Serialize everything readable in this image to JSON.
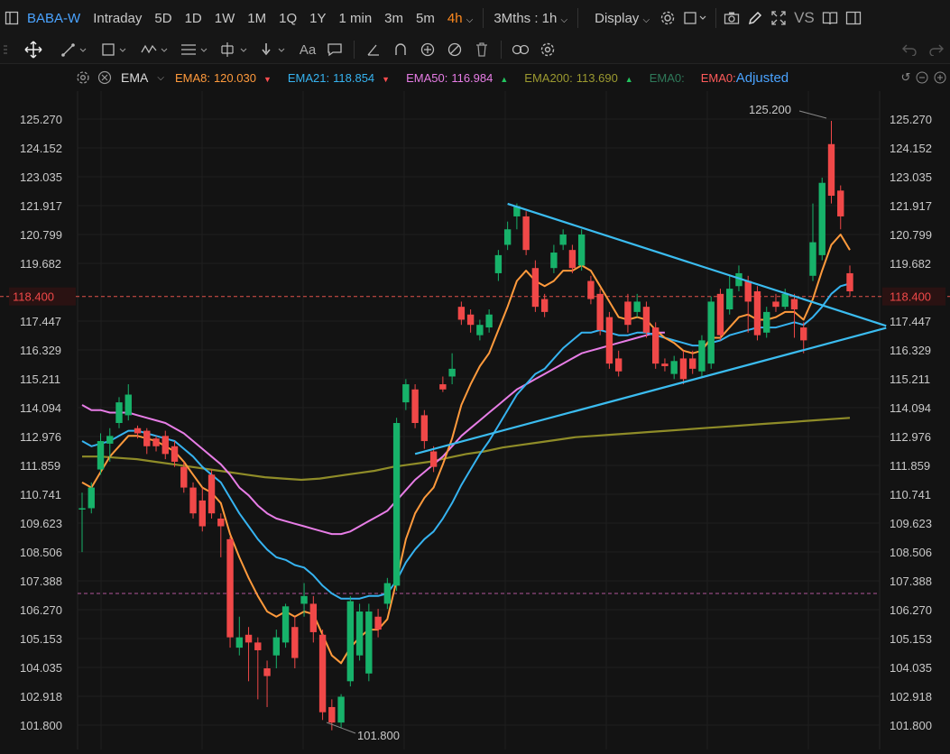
{
  "topbar": {
    "symbol": "BABA-W",
    "periods": [
      "Intraday",
      "5D",
      "1D",
      "1W",
      "1M",
      "1Q",
      "1Y",
      "1 min",
      "3m",
      "5m"
    ],
    "active_period": "4h",
    "range_label": "3Mths : 1h",
    "display_label": "Display",
    "vs_label": "VS"
  },
  "toolbar": {
    "text_tool_label": "Aa"
  },
  "indicators": {
    "name": "EMA",
    "items": [
      {
        "label": "EMA8:",
        "value": "120.030",
        "color": "#ff9a3c",
        "arrow": "▼",
        "arrow_color": "#ff4d4f"
      },
      {
        "label": "EMA21:",
        "value": "118.854",
        "color": "#36b3f0",
        "arrow": "▼",
        "arrow_color": "#ff4d4f"
      },
      {
        "label": "EMA50:",
        "value": "116.984",
        "color": "#e77de6",
        "arrow": "▲",
        "arrow_color": "#22c55e"
      },
      {
        "label": "EMA200:",
        "value": "113.690",
        "color": "#9c9a30",
        "arrow": "▲",
        "arrow_color": "#22c55e"
      },
      {
        "label": "EMA0:",
        "value": "",
        "color": "#2f7a5a",
        "arrow": "",
        "arrow_color": ""
      },
      {
        "label": "EMA0:",
        "value": "Adjusted",
        "color": "#ff5b5b",
        "arrow": "",
        "arrow_color": ""
      }
    ]
  },
  "colors": {
    "up": "#17b26a",
    "down": "#f04848",
    "ema8": "#ff9a3c",
    "ema21": "#36b3f0",
    "ema50": "#e77de6",
    "ema200": "#8f8c28",
    "trendline": "#3bbcf0"
  },
  "price_axis": {
    "ticks": [
      "125.270",
      "124.152",
      "123.035",
      "121.917",
      "120.799",
      "119.682",
      "118.400",
      "117.447",
      "116.329",
      "115.211",
      "114.094",
      "112.976",
      "111.859",
      "110.741",
      "109.623",
      "108.506",
      "107.388",
      "106.270",
      "105.153",
      "104.035",
      "102.918",
      "101.800"
    ],
    "current_price": "118.400",
    "reference_level": 106.9
  },
  "chart_data": {
    "type": "candlestick",
    "ylim": [
      101.2,
      126.0
    ],
    "high_label": "125.200",
    "low_label": "101.800",
    "candles": [
      [
        110.2,
        110.2,
        110.8,
        108.5
      ],
      [
        110.2,
        111.0,
        111.2,
        110.0
      ],
      [
        111.7,
        112.8,
        113.1,
        111.5
      ],
      [
        112.7,
        113.0,
        113.3,
        112.0
      ],
      [
        113.5,
        114.3,
        114.5,
        113.3
      ],
      [
        113.8,
        114.6,
        115.0,
        113.6
      ],
      [
        113.3,
        113.1,
        113.4,
        112.9
      ],
      [
        113.2,
        112.6,
        113.3,
        112.3
      ],
      [
        112.9,
        112.6,
        113.0,
        112.4
      ],
      [
        113.0,
        112.3,
        113.2,
        112.1
      ],
      [
        112.6,
        112.0,
        112.8,
        111.8
      ],
      [
        111.8,
        111.0,
        112.0,
        110.8
      ],
      [
        111.0,
        110.0,
        111.2,
        109.8
      ],
      [
        110.5,
        109.5,
        111.0,
        109.3
      ],
      [
        111.5,
        110.0,
        111.7,
        109.8
      ],
      [
        109.8,
        109.5,
        110.0,
        108.3
      ],
      [
        109.0,
        105.2,
        109.1,
        104.8
      ],
      [
        104.8,
        105.2,
        106.0,
        104.5
      ],
      [
        105.3,
        105.0,
        105.6,
        103.5
      ],
      [
        105.0,
        104.7,
        105.2,
        102.8
      ],
      [
        104.0,
        103.7,
        104.3,
        102.5
      ],
      [
        104.5,
        105.2,
        105.5,
        104.0
      ],
      [
        105.0,
        106.4,
        106.5,
        104.8
      ],
      [
        105.6,
        104.4,
        106.0,
        104.0
      ],
      [
        106.5,
        106.8,
        107.3,
        106.0
      ],
      [
        106.5,
        105.4,
        106.8,
        105.0
      ],
      [
        105.3,
        102.3,
        105.5,
        102.0
      ],
      [
        102.5,
        101.9,
        102.8,
        101.6
      ],
      [
        101.9,
        102.9,
        103.0,
        101.7
      ],
      [
        103.5,
        106.6,
        106.8,
        103.3
      ],
      [
        104.5,
        106.2,
        106.5,
        104.3
      ],
      [
        103.8,
        106.2,
        106.5,
        103.5
      ],
      [
        106.0,
        105.5,
        106.3,
        105.2
      ],
      [
        106.5,
        107.3,
        107.5,
        106.3
      ],
      [
        107.2,
        113.5,
        113.7,
        107.0
      ],
      [
        114.3,
        115.0,
        115.2,
        114.0
      ],
      [
        114.8,
        113.5,
        115.0,
        113.3
      ],
      [
        113.8,
        112.8,
        114.0,
        112.5
      ],
      [
        112.4,
        111.8,
        112.6,
        111.6
      ],
      [
        115.0,
        114.8,
        115.3,
        114.7
      ],
      [
        115.3,
        115.6,
        116.2,
        115.0
      ],
      [
        118.0,
        117.5,
        118.2,
        117.3
      ],
      [
        117.7,
        117.3,
        117.9,
        117.0
      ],
      [
        116.9,
        117.3,
        117.5,
        116.7
      ],
      [
        117.2,
        117.7,
        117.9,
        117.0
      ],
      [
        119.3,
        120.0,
        120.2,
        119.0
      ],
      [
        120.4,
        121.0,
        121.3,
        120.2
      ],
      [
        121.5,
        121.9,
        122.0,
        121.0
      ],
      [
        121.5,
        120.2,
        121.7,
        120.0
      ],
      [
        119.5,
        118.0,
        119.8,
        117.8
      ],
      [
        118.3,
        117.8,
        118.5,
        117.6
      ],
      [
        119.5,
        120.1,
        120.4,
        119.3
      ],
      [
        120.4,
        120.8,
        121.0,
        120.2
      ],
      [
        120.2,
        119.5,
        120.4,
        119.3
      ],
      [
        119.6,
        120.8,
        121.0,
        119.4
      ],
      [
        119.0,
        118.3,
        119.2,
        118.1
      ],
      [
        118.5,
        117.1,
        118.7,
        116.9
      ],
      [
        117.6,
        115.8,
        117.8,
        115.6
      ],
      [
        116.0,
        115.5,
        116.3,
        115.3
      ],
      [
        118.2,
        117.3,
        118.5,
        117.0
      ],
      [
        117.8,
        118.2,
        118.5,
        117.6
      ],
      [
        118.0,
        117.0,
        118.2,
        116.8
      ],
      [
        117.2,
        115.8,
        117.4,
        115.6
      ],
      [
        115.8,
        115.7,
        116.0,
        115.5
      ],
      [
        115.4,
        115.9,
        116.1,
        115.2
      ],
      [
        116.0,
        115.2,
        116.3,
        115.0
      ],
      [
        116.0,
        115.6,
        116.3,
        115.4
      ],
      [
        115.5,
        116.7,
        116.9,
        115.3
      ],
      [
        115.8,
        118.2,
        118.4,
        115.6
      ],
      [
        118.5,
        116.9,
        118.7,
        116.7
      ],
      [
        117.9,
        118.7,
        119.2,
        117.7
      ],
      [
        118.8,
        119.3,
        119.6,
        118.6
      ],
      [
        119.0,
        118.2,
        119.2,
        117.0
      ],
      [
        118.6,
        116.9,
        118.8,
        116.7
      ],
      [
        117.0,
        117.8,
        118.0,
        116.8
      ],
      [
        118.2,
        118.0,
        118.5,
        117.8
      ],
      [
        118.0,
        118.5,
        118.7,
        117.9
      ],
      [
        118.3,
        117.9,
        118.5,
        116.8
      ],
      [
        117.2,
        116.7,
        117.4,
        116.2
      ],
      [
        119.2,
        120.5,
        122.0,
        119.0
      ],
      [
        120.0,
        122.8,
        123.0,
        119.8
      ],
      [
        124.3,
        122.3,
        125.2,
        122.0
      ],
      [
        122.5,
        121.5,
        122.7,
        121.0
      ],
      [
        119.3,
        118.6,
        119.6,
        118.4
      ]
    ],
    "ema8": [
      111.2,
      111.0,
      111.6,
      112.2,
      112.6,
      113.0,
      113.0,
      112.9,
      112.8,
      112.6,
      112.4,
      112.0,
      111.5,
      111.0,
      110.8,
      110.4,
      109.2,
      108.3,
      107.5,
      106.8,
      106.2,
      106.0,
      106.2,
      106.0,
      106.2,
      106.1,
      105.3,
      104.5,
      104.2,
      104.8,
      105.2,
      105.5,
      105.5,
      105.9,
      107.4,
      109.0,
      110.0,
      110.6,
      111.0,
      111.9,
      112.9,
      114.2,
      115.0,
      115.7,
      116.2,
      117.1,
      118.0,
      119.0,
      119.4,
      119.0,
      118.8,
      119.0,
      119.4,
      119.4,
      119.6,
      119.4,
      118.8,
      118.2,
      117.6,
      117.5,
      117.6,
      117.5,
      117.1,
      116.8,
      116.6,
      116.3,
      116.2,
      116.3,
      116.8,
      116.8,
      117.2,
      117.6,
      117.7,
      117.5,
      117.5,
      117.6,
      117.8,
      117.8,
      117.5,
      118.3,
      119.4,
      120.4,
      120.8,
      120.2
    ],
    "ema21": [
      112.8,
      112.6,
      112.7,
      112.8,
      113.0,
      113.2,
      113.2,
      113.1,
      113.0,
      112.9,
      112.8,
      112.5,
      112.2,
      111.8,
      111.5,
      111.2,
      110.6,
      110.0,
      109.5,
      109.0,
      108.6,
      108.3,
      108.2,
      108.0,
      107.9,
      107.6,
      107.2,
      106.9,
      106.7,
      106.7,
      106.7,
      106.8,
      106.8,
      106.9,
      107.4,
      108.1,
      108.6,
      109.0,
      109.3,
      109.8,
      110.4,
      111.1,
      111.7,
      112.3,
      112.8,
      113.4,
      114.0,
      114.6,
      115.0,
      115.4,
      115.6,
      116.0,
      116.4,
      116.7,
      117.0,
      117.0,
      117.1,
      117.0,
      116.9,
      116.9,
      117.0,
      117.0,
      116.9,
      116.8,
      116.7,
      116.6,
      116.5,
      116.5,
      116.6,
      116.7,
      116.9,
      117.0,
      117.1,
      117.2,
      117.2,
      117.2,
      117.3,
      117.4,
      117.3,
      117.6,
      118.0,
      118.5,
      118.8,
      118.9
    ],
    "ema50": [
      114.2,
      114.0,
      114.0,
      113.9,
      113.9,
      113.9,
      113.8,
      113.7,
      113.6,
      113.5,
      113.3,
      113.1,
      112.8,
      112.5,
      112.2,
      111.9,
      111.5,
      111.0,
      110.7,
      110.3,
      110.0,
      109.8,
      109.7,
      109.6,
      109.5,
      109.4,
      109.3,
      109.2,
      109.2,
      109.3,
      109.5,
      109.7,
      109.9,
      110.1,
      110.5,
      110.9,
      111.3,
      111.6,
      111.9,
      112.2,
      112.6,
      113.0,
      113.3,
      113.6,
      113.9,
      114.2,
      114.5,
      114.8,
      115.0,
      115.2,
      115.4,
      115.6,
      115.8,
      116.0,
      116.2,
      116.3,
      116.4,
      116.5,
      116.6,
      116.7,
      116.8,
      116.9,
      117.0,
      117.0
    ],
    "ema200": [
      112.2,
      112.2,
      112.2,
      112.2,
      112.2,
      112.2,
      112.1,
      112.1,
      112.0,
      111.9,
      111.8,
      111.7,
      111.6,
      111.5,
      111.4,
      111.4,
      111.3,
      111.4,
      111.5,
      111.6,
      111.8,
      111.9,
      112.0,
      112.2,
      112.3,
      112.5,
      112.6,
      112.8,
      112.9,
      113.0,
      113.1,
      113.2,
      113.3,
      113.4,
      113.6,
      113.7,
      113.8,
      114.0,
      114.1,
      114.3,
      114.4,
      114.5,
      114.7,
      114.8,
      115.0,
      115.1,
      115.2,
      115.3,
      115.5,
      115.6,
      115.7,
      115.9,
      116.0,
      116.1,
      116.3,
      116.4,
      116.5,
      116.6,
      116.8,
      116.9,
      117.0,
      117.1,
      117.2,
      117.3,
      117.4,
      117.5,
      117.6,
      117.6,
      117.7,
      117.8,
      117.9,
      118.0,
      118.1,
      118.1,
      118.2,
      118.3,
      118.3,
      118.4,
      118.4,
      118.5,
      118.6,
      118.7,
      118.8,
      118.9,
      119.0,
      119.1,
      119.2,
      119.3,
      119.4,
      119.5,
      119.6,
      119.6,
      119.7,
      119.8,
      119.8,
      119.9,
      120.0,
      120.0,
      120.1,
      120.2,
      120.2,
      120.3,
      120.4,
      120.5,
      120.5,
      120.6,
      120.7,
      120.8,
      120.9,
      121.0,
      121.1,
      121.2,
      121.3,
      121.4,
      121.5,
      121.6,
      121.7,
      121.8,
      121.8,
      121.9,
      122.0,
      122.1,
      122.2,
      122.3,
      122.4,
      122.5,
      122.6,
      122.7,
      122.8,
      122.9,
      123.0,
      123.1,
      123.2,
      123.3,
      123.4,
      123.5,
      123.6,
      123.7,
      123.8,
      123.9,
      124.0,
      124.1,
      124.2,
      124.3,
      124.4,
      124.5,
      124.6,
      124.7,
      124.8,
      124.9,
      125.0,
      125.1,
      125.2,
      125.3,
      125.4,
      125.5,
      125.6,
      125.7,
      125.8,
      125.9,
      126.0,
      126.1,
      126.2,
      126.3,
      126.4,
      126.5,
      126.6,
      126.7,
      126.8,
      126.9,
      127.0,
      127.1,
      127.2,
      127.3,
      127.4,
      127.5,
      127.6,
      127.7,
      127.8,
      127.9,
      128.0,
      128.1,
      128.2,
      128.3,
      128.4,
      128.5,
      128.6,
      128.7,
      128.8,
      128.9,
      129.0,
      129.1,
      129.2,
      129.3,
      129.4,
      129.5,
      129.6,
      129.7,
      129.8,
      129.9,
      130.0,
      130.1,
      130.2,
      130.3,
      130.4,
      130.5,
      130.6,
      130.7,
      130.8,
      130.9,
      131.0,
      131.1,
      131.2,
      131.3,
      131.4,
      131.5,
      131.6,
      131.7,
      131.8,
      131.9,
      132.0,
      132.1,
      132.2,
      132.3,
      132.4,
      132.5,
      132.6,
      132.7,
      132.8,
      132.9,
      133.0,
      133.1,
      133.2,
      133.3,
      133.4,
      133.5,
      133.6,
      133.7,
      133.8,
      133.9,
      134.0,
      134.1,
      134.2,
      134.3,
      134.4,
      134.5,
      134.6,
      134.7,
      134.8,
      134.9,
      135.0,
      135.1,
      135.2,
      135.3,
      135.4,
      135.5,
      135.6,
      135.7,
      135.8,
      135.9,
      136.0,
      136.1,
      136.2,
      136.3,
      136.4,
      136.5,
      136.6,
      136.7,
      136.8,
      136.9,
      137.0,
      137.1,
      137.2,
      137.3,
      137.4,
      137.5,
      137.6,
      137.7,
      137.8,
      137.9,
      138.0,
      138.1,
      138.2,
      138.3,
      138.4,
      138.5,
      138.6,
      138.7,
      138.8,
      138.9,
      139.0,
      139.1,
      139.2,
      139.3,
      139.4,
      139.5,
      139.6,
      139.7,
      139.8,
      139.9,
      140.0
    ],
    "trendlines": [
      {
        "name": "upper-trendline",
        "points": [
          [
            46,
            121.99
          ],
          [
            84,
            117.6
          ]
        ]
      },
      {
        "name": "lower-trendline",
        "points": [
          [
            36,
            112.3
          ],
          [
            84,
            116.9
          ]
        ]
      }
    ]
  }
}
